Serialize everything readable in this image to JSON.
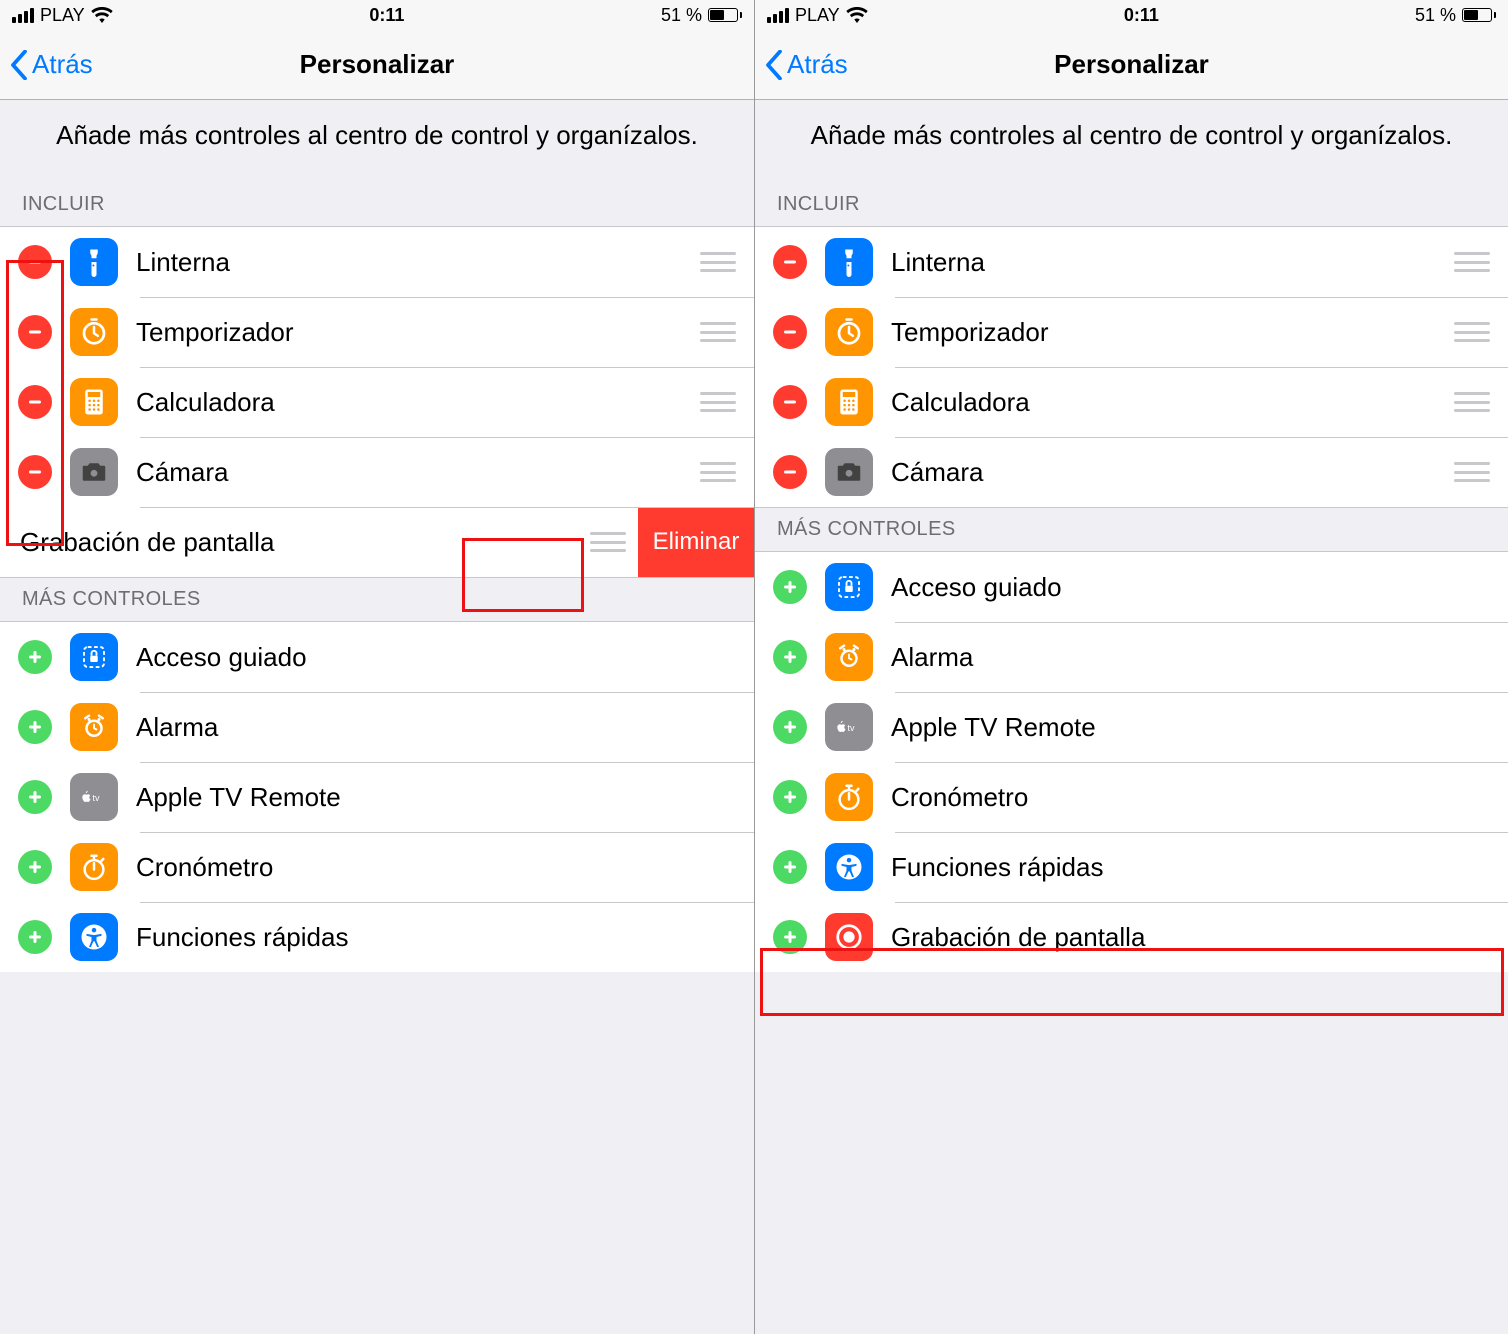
{
  "status": {
    "carrier": "PLAY",
    "time": "0:11",
    "battery_pct": "51 %"
  },
  "nav": {
    "back": "Atrás",
    "title": "Personalizar"
  },
  "intro": "Añade más controles al centro de control y organízalos.",
  "sections": {
    "include": "INCLUIR",
    "more": "MÁS CONTROLES"
  },
  "delete_label": "Eliminar",
  "left": {
    "include": [
      {
        "label": "Linterna",
        "icon": "flashlight"
      },
      {
        "label": "Temporizador",
        "icon": "timer"
      },
      {
        "label": "Calculadora",
        "icon": "calculator"
      },
      {
        "label": "Cámara",
        "icon": "camera"
      },
      {
        "label": "Grabación de pantalla",
        "icon": "screen-record",
        "swiped": true
      }
    ],
    "more": [
      {
        "label": "Acceso guiado",
        "icon": "guided"
      },
      {
        "label": "Alarma",
        "icon": "alarm"
      },
      {
        "label": "Apple TV Remote",
        "icon": "appletv"
      },
      {
        "label": "Cronómetro",
        "icon": "stopwatch"
      },
      {
        "label": "Funciones rápidas",
        "icon": "accessibility"
      }
    ]
  },
  "right": {
    "include": [
      {
        "label": "Linterna",
        "icon": "flashlight"
      },
      {
        "label": "Temporizador",
        "icon": "timer"
      },
      {
        "label": "Calculadora",
        "icon": "calculator"
      },
      {
        "label": "Cámara",
        "icon": "camera"
      }
    ],
    "more": [
      {
        "label": "Acceso guiado",
        "icon": "guided"
      },
      {
        "label": "Alarma",
        "icon": "alarm"
      },
      {
        "label": "Apple TV Remote",
        "icon": "appletv"
      },
      {
        "label": "Cronómetro",
        "icon": "stopwatch"
      },
      {
        "label": "Funciones rápidas",
        "icon": "accessibility"
      },
      {
        "label": "Grabación de pantalla",
        "icon": "screen-record"
      }
    ]
  },
  "highlights": {
    "left_remove_col": true,
    "left_delete_btn": true,
    "right_last_row": true
  }
}
